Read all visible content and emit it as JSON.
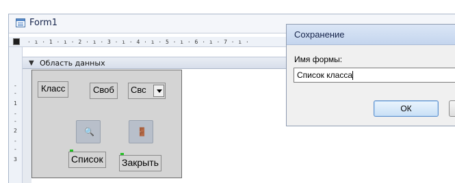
{
  "window": {
    "title": "Form1"
  },
  "ruler": {
    "ticks": "· ı · 1 · ı · 2 · ı · 3 · ı · 4 · ı · 5 · ı · 6 · ı · 7 · ı ·",
    "vertical": [
      "-",
      "-",
      "1",
      "-",
      "-",
      "2",
      "-",
      "-",
      "3"
    ]
  },
  "designer": {
    "section_label": "Область данных",
    "controls": {
      "label_class": "Класс",
      "label_svob": "Своб",
      "combo_text": "Свс",
      "caption_list": "Список",
      "caption_close": "Закрыть"
    },
    "icons": {
      "find_button": "binoculars-icon",
      "close_button": "exit-door-icon"
    }
  },
  "dialog": {
    "title": "Сохранение",
    "label": "Имя формы:",
    "input_value": "Список класса",
    "ok_label": "ОК"
  }
}
